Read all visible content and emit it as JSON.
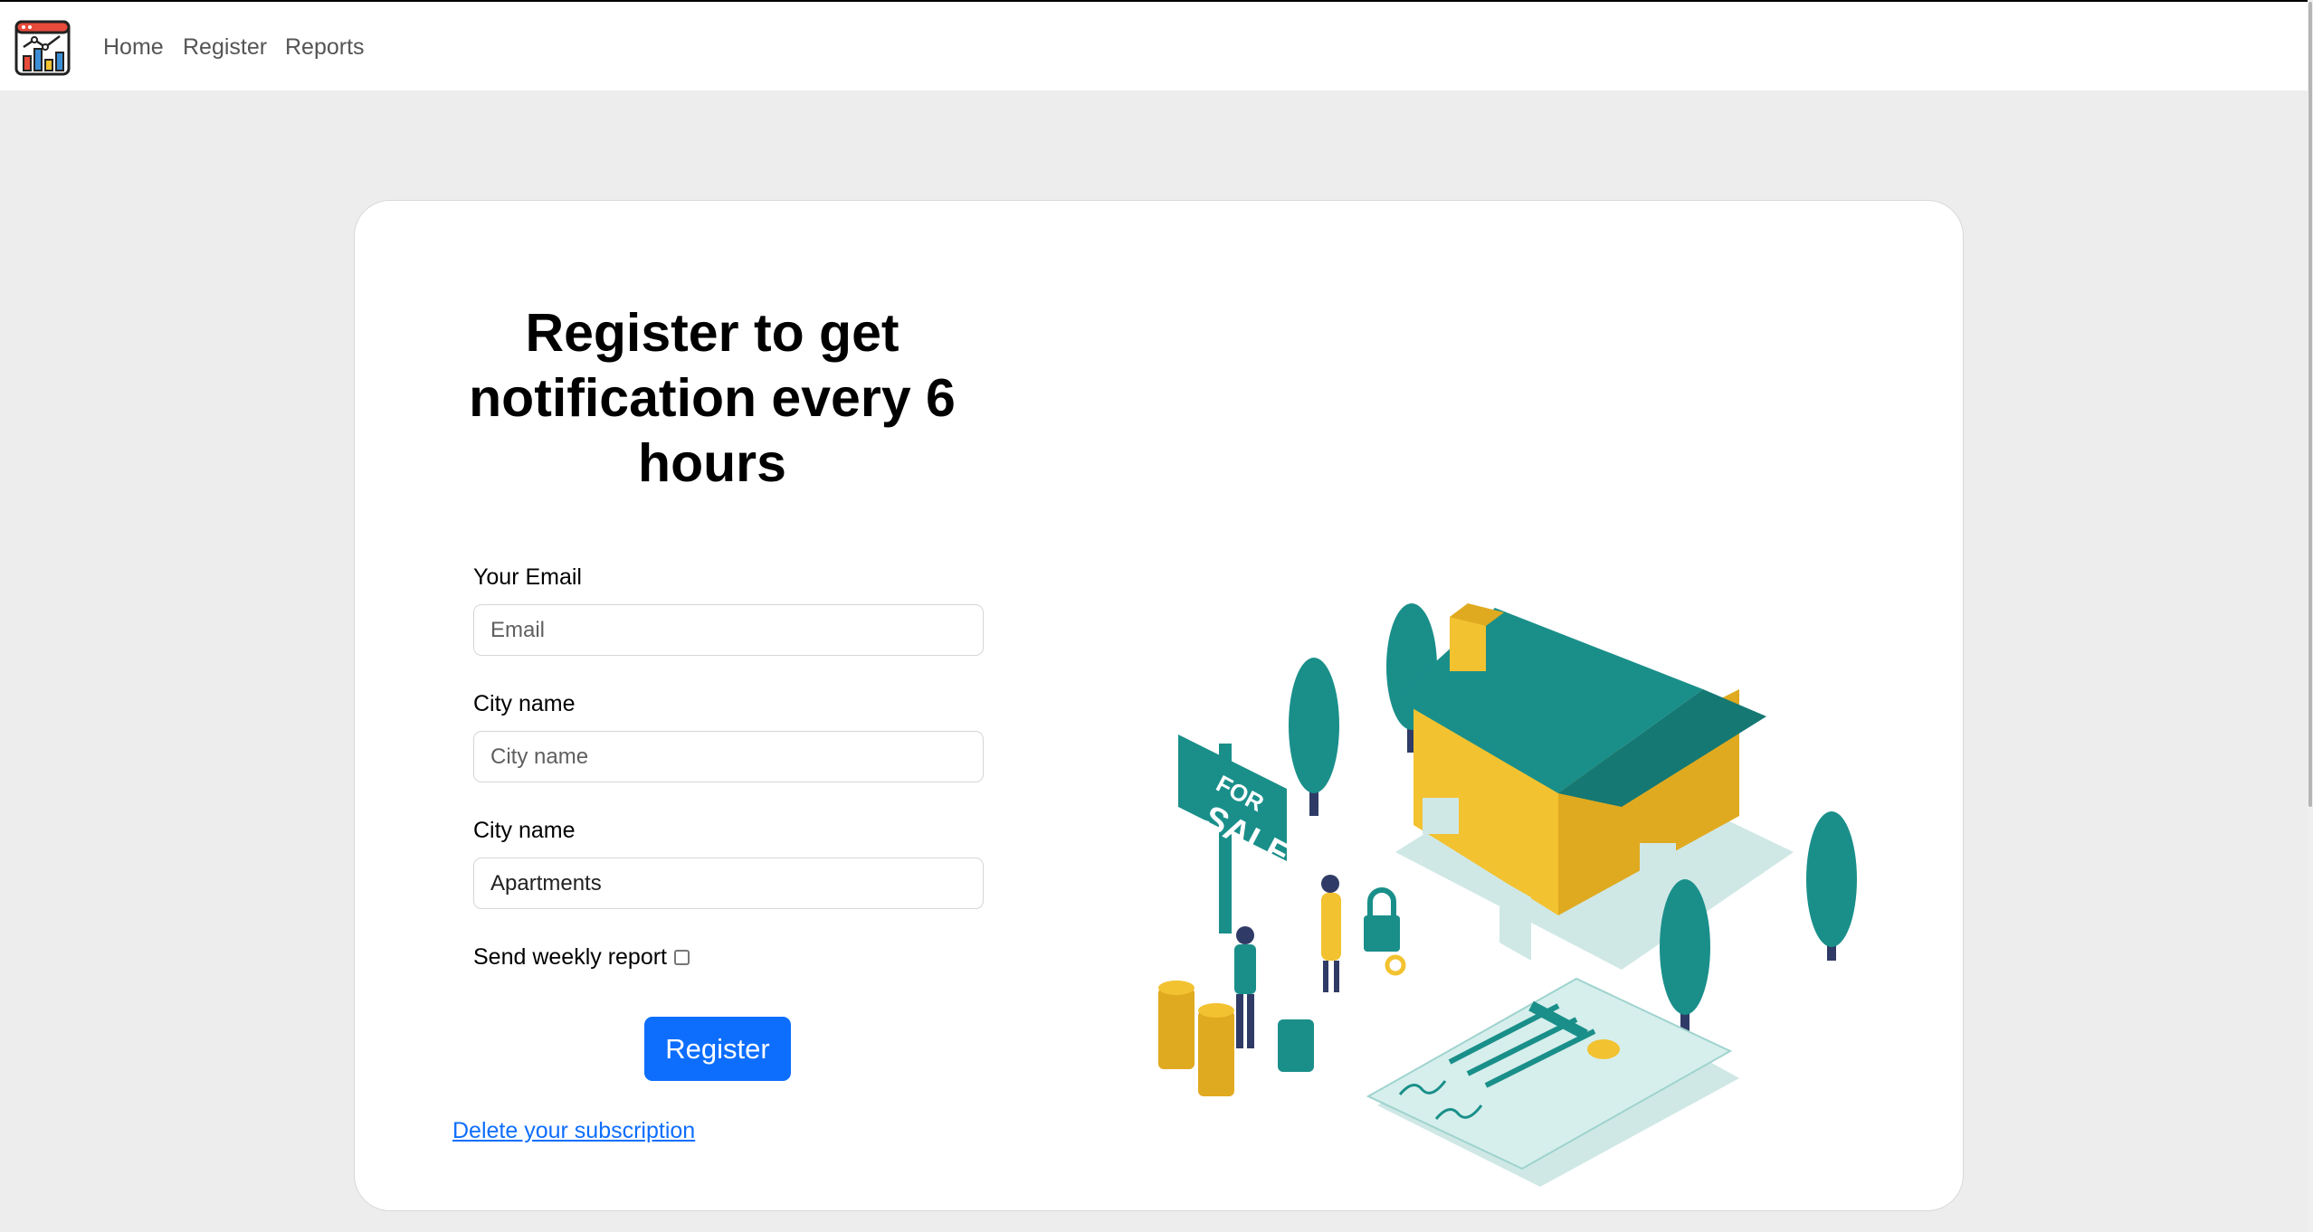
{
  "nav": {
    "links": [
      "Home",
      "Register",
      "Reports"
    ]
  },
  "form": {
    "title": "Register to get notification every 6 hours",
    "email_label": "Your Email",
    "email_placeholder": "Email",
    "city_label": "City name",
    "city_placeholder": "City name",
    "type_label": "City name",
    "type_value": "Apartments",
    "weekly_label": "Send weekly report",
    "weekly_checked": false,
    "register_label": "Register",
    "delete_link": "Delete your subscription"
  },
  "illustration": {
    "sign_text": [
      "FOR",
      "SALE"
    ]
  },
  "colors": {
    "accent": "#0d6efd",
    "teal": "#1a8f8a",
    "yellow": "#f2c230"
  }
}
